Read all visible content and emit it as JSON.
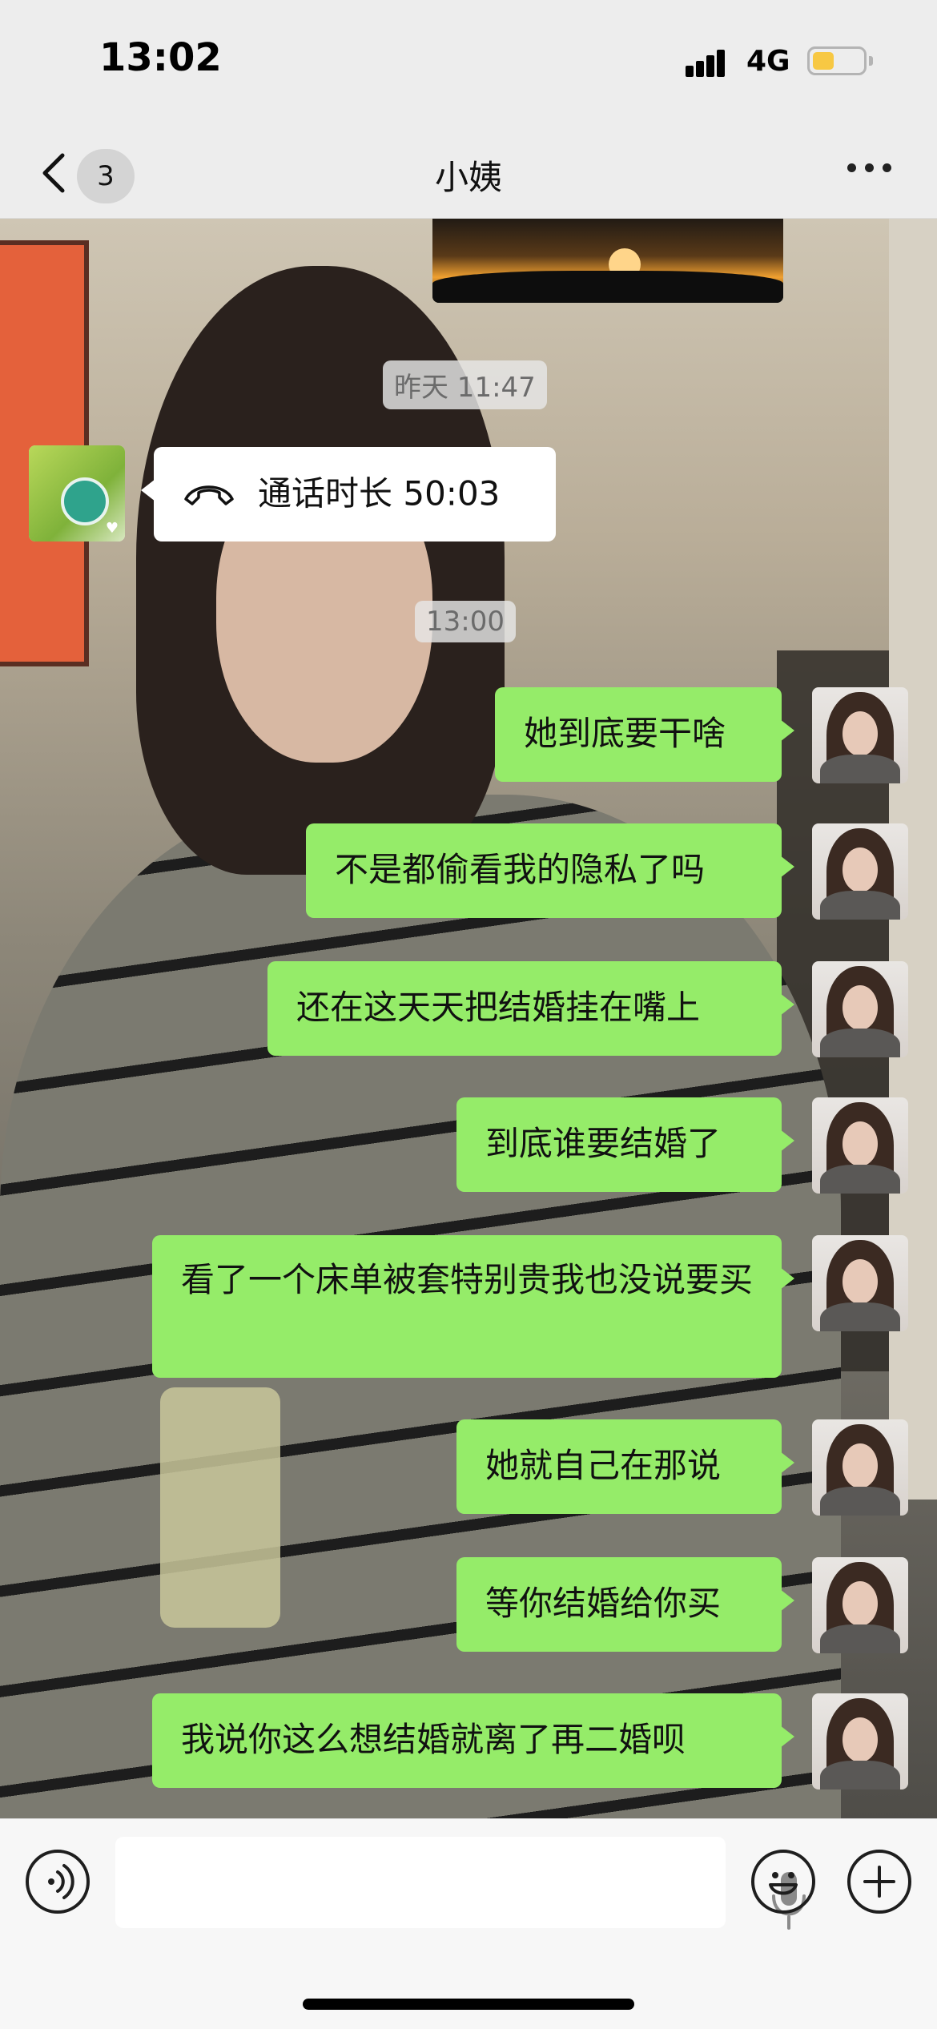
{
  "status_bar": {
    "time": "13:02",
    "network": "4G",
    "battery_color": "#f7c843"
  },
  "nav": {
    "unread_count": "3",
    "title": "小姨",
    "back_icon": "chevron-left-icon",
    "more_icon": "more-dots-icon"
  },
  "colors": {
    "outgoing_bubble": "#95ec69",
    "incoming_bubble": "#ffffff",
    "background": "#ededed"
  },
  "messages": {
    "timestamp_1": "昨天 11:47",
    "call": {
      "icon": "phone-hangup-icon",
      "label": "通话时长 50:03"
    },
    "timestamp_2": "13:00",
    "outgoing": [
      "她到底要干啥",
      "不是都偷看我的隐私了吗",
      "还在这天天把结婚挂在嘴上",
      "到底谁要结婚了",
      "看了一个床单被套特别贵我也没说要买",
      "她就自己在那说",
      "等你结婚给你买",
      "我说你这么想结婚就离了再二婚呗"
    ]
  },
  "input_bar": {
    "voice_icon": "voice-mode-icon",
    "mic_icon": "microphone-icon",
    "emoji_icon": "emoji-icon",
    "plus_icon": "plus-icon"
  }
}
